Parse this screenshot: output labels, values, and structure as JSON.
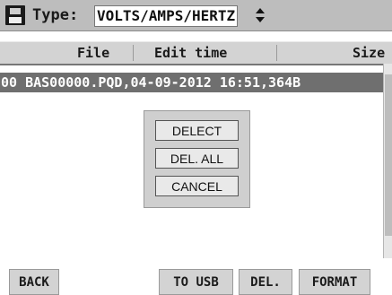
{
  "header": {
    "type_label": "Type:",
    "type_value": "VOLTS/AMPS/HERTZ",
    "spinner_glyph": "▴▾"
  },
  "columns": {
    "file": "File",
    "edit_time": "Edit time",
    "size": "Size"
  },
  "file_list": {
    "rows": [
      "00 BAS00000.PQD,04-09-2012 16:51,364B"
    ]
  },
  "popup": {
    "buttons": [
      "DELECT",
      "DEL. ALL",
      "CANCEL"
    ]
  },
  "softkeys": {
    "back": "BACK",
    "to_usb": "TO USB",
    "del": "DEL.",
    "format": "FORMAT"
  }
}
